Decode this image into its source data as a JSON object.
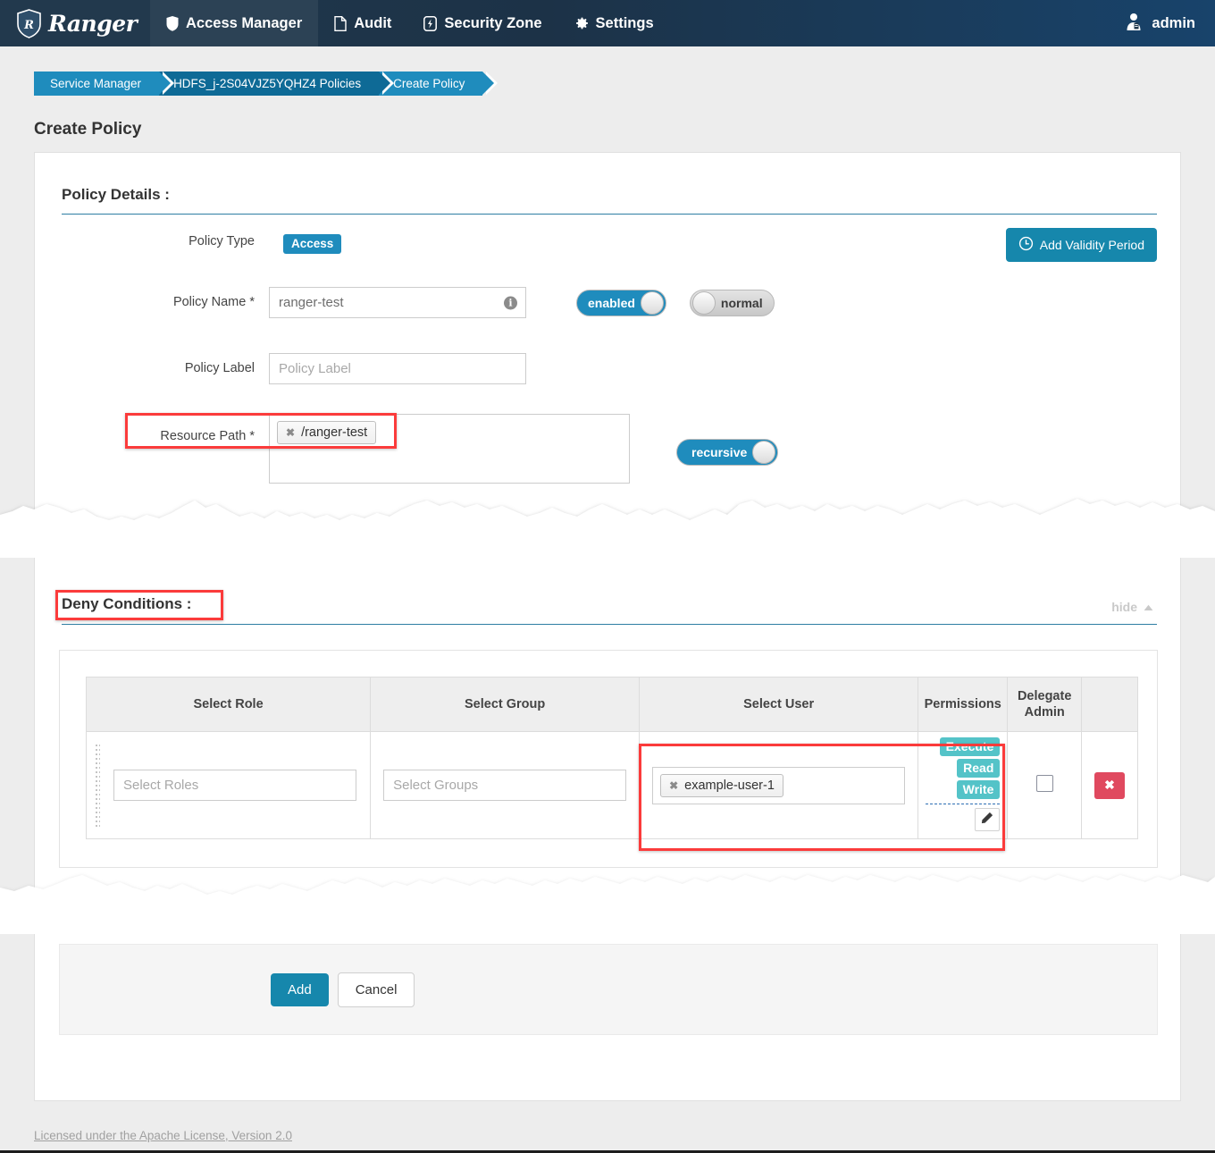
{
  "header": {
    "brand": "Ranger",
    "nav": [
      {
        "label": "Access Manager",
        "icon": "shield-icon",
        "active": true
      },
      {
        "label": "Audit",
        "icon": "file-icon",
        "active": false
      },
      {
        "label": "Security Zone",
        "icon": "bolt-icon",
        "active": false
      },
      {
        "label": "Settings",
        "icon": "gear-icon",
        "active": false
      }
    ],
    "user": "admin"
  },
  "breadcrumb": [
    {
      "label": "Service Manager"
    },
    {
      "label": "HDFS_j-2S04VJZ5YQHZ4 Policies"
    },
    {
      "label": "Create Policy"
    }
  ],
  "page_title": "Create Policy",
  "policy_details": {
    "heading": "Policy Details :",
    "add_validity_label": "Add Validity Period",
    "policy_type_label": "Policy Type",
    "policy_type_value": "Access",
    "policy_name_label": "Policy Name *",
    "policy_name_value": "ranger-test",
    "policy_name_info": "i",
    "enabled_toggle": "enabled",
    "normal_toggle": "normal",
    "policy_label_label": "Policy Label",
    "policy_label_placeholder": "Policy Label",
    "resource_path_label": "Resource Path *",
    "resource_path_chip": "/ranger-test",
    "recursive_toggle": "recursive"
  },
  "deny_conditions": {
    "heading": "Deny Conditions :",
    "hide_label": "hide",
    "columns": [
      "Select Role",
      "Select Group",
      "Select User",
      "Permissions",
      "Delegate Admin",
      ""
    ],
    "row": {
      "roles_placeholder": "Select Roles",
      "groups_placeholder": "Select Groups",
      "user_chip": "example-user-1",
      "permissions": [
        "Execute",
        "Read",
        "Write"
      ],
      "edit_icon": "pencil-icon",
      "delegate_admin_checked": false,
      "delete_label": "✖"
    }
  },
  "actions": {
    "add": "Add",
    "cancel": "Cancel"
  },
  "footer": "Licensed under the Apache License, Version 2.0",
  "colors": {
    "accent": "#1f8cbd",
    "brand_dark": "#22394d",
    "permission": "#54c3c8",
    "danger": "#e0495f",
    "highlight": "#fb3b3b"
  }
}
